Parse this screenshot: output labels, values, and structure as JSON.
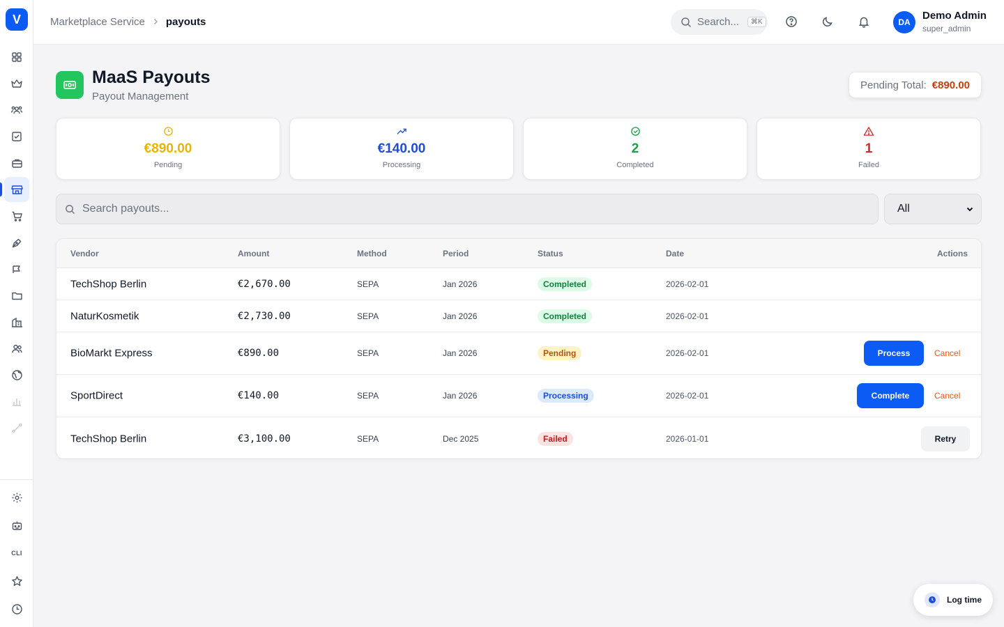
{
  "app": {
    "logo_letter": "V"
  },
  "breadcrumb": {
    "parent": "Marketplace Service",
    "current": "payouts"
  },
  "header": {
    "search_placeholder": "Search...",
    "search_shortcut": "⌘K",
    "user_initials": "DA",
    "user_name": "Demo Admin",
    "user_role": "super_admin"
  },
  "sidebar": {
    "items": [
      {
        "icon": "dashboard-grid-icon"
      },
      {
        "icon": "crown-icon"
      },
      {
        "icon": "users-group-icon"
      },
      {
        "icon": "checkbox-icon"
      },
      {
        "icon": "briefcase-icon"
      },
      {
        "icon": "storefront-icon",
        "active": true
      },
      {
        "icon": "cart-icon"
      },
      {
        "icon": "pen-nib-icon"
      },
      {
        "icon": "megaphone-icon"
      },
      {
        "icon": "folder-icon"
      },
      {
        "icon": "buildings-icon"
      },
      {
        "icon": "people-icon"
      },
      {
        "icon": "globe-icon"
      },
      {
        "icon": "bar-chart-icon",
        "muted": true
      },
      {
        "icon": "route-icon",
        "muted": true
      }
    ],
    "bottom": [
      {
        "icon": "gear-icon"
      },
      {
        "icon": "robot-icon"
      },
      {
        "icon": "cli-icon",
        "label": "CLI"
      },
      {
        "icon": "star-icon"
      },
      {
        "icon": "clock-icon"
      }
    ]
  },
  "page": {
    "title": "MaaS Payouts",
    "subtitle": "Payout Management",
    "pending_total_label": "Pending Total:",
    "pending_total_value": "€890.00"
  },
  "stats": [
    {
      "value": "€890.00",
      "label": "Pending",
      "color": "#eab308",
      "icon": "clock-icon"
    },
    {
      "value": "€140.00",
      "label": "Processing",
      "color": "#1d4ed8",
      "icon": "trending-up-icon"
    },
    {
      "value": "2",
      "label": "Completed",
      "color": "#16a34a",
      "icon": "check-circle-icon"
    },
    {
      "value": "1",
      "label": "Failed",
      "color": "#dc2626",
      "icon": "warning-icon"
    }
  ],
  "filters": {
    "search_placeholder": "Search payouts...",
    "status_selected": "All"
  },
  "table": {
    "headers": {
      "vendor": "Vendor",
      "amount": "Amount",
      "method": "Method",
      "period": "Period",
      "status": "Status",
      "date": "Date",
      "actions": "Actions"
    },
    "rows": [
      {
        "vendor": "TechShop Berlin",
        "amount": "€2,670.00",
        "method": "SEPA",
        "period": "Jan 2026",
        "status": "Completed",
        "date": "2026-02-01"
      },
      {
        "vendor": "NaturKosmetik",
        "amount": "€2,730.00",
        "method": "SEPA",
        "period": "Jan 2026",
        "status": "Completed",
        "date": "2026-02-01"
      },
      {
        "vendor": "BioMarkt Express",
        "amount": "€890.00",
        "method": "SEPA",
        "period": "Jan 2026",
        "status": "Pending",
        "date": "2026-02-01",
        "primary_action": "Process",
        "secondary_action": "Cancel"
      },
      {
        "vendor": "SportDirect",
        "amount": "€140.00",
        "method": "SEPA",
        "period": "Jan 2026",
        "status": "Processing",
        "date": "2026-02-01",
        "primary_action": "Complete",
        "secondary_action": "Cancel"
      },
      {
        "vendor": "TechShop Berlin",
        "amount": "€3,100.00",
        "method": "SEPA",
        "period": "Dec 2025",
        "status": "Failed",
        "date": "2026-01-01",
        "primary_action": "Retry"
      }
    ]
  },
  "log_time": {
    "label": "Log time"
  }
}
